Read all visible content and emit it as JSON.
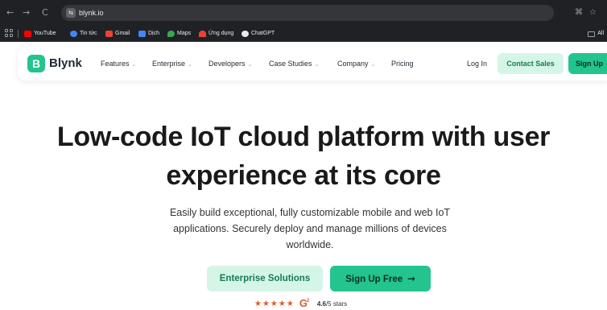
{
  "browser": {
    "url": "blynk.io",
    "site_icon": "⇆",
    "back_icon": "←",
    "forward_icon": "→",
    "reload_icon": "C",
    "translate_icon": "⌘",
    "bookmark_star_icon": "☆",
    "bookmarks": [
      {
        "label": "YouTube",
        "icon": "youtube-icon",
        "color": "#ff0000"
      },
      {
        "label": "Tin tức",
        "icon": "news-icon",
        "color": "#4285f4"
      },
      {
        "label": "Gmail",
        "icon": "gmail-icon",
        "color": "#ea4335"
      },
      {
        "label": "Dịch",
        "icon": "translate-icon",
        "color": "#4285f4"
      },
      {
        "label": "Maps",
        "icon": "maps-icon",
        "color": "#34a853"
      },
      {
        "label": "Ứng dụng",
        "icon": "apps-icon",
        "color": "#ea4335"
      },
      {
        "label": "ChatGPT",
        "icon": "chatgpt-icon",
        "color": "#e8eaed"
      }
    ],
    "all_bookmarks_label": "All"
  },
  "header": {
    "logo_mark": "B",
    "logo_text": "Blynk",
    "nav": [
      {
        "label": "Features",
        "dropdown": true
      },
      {
        "label": "Enterprise",
        "dropdown": true
      },
      {
        "label": "Developers",
        "dropdown": true
      },
      {
        "label": "Case Studies",
        "dropdown": true
      },
      {
        "label": "Company",
        "dropdown": true
      },
      {
        "label": "Pricing",
        "dropdown": false
      }
    ],
    "chevron": "⌄",
    "login_label": "Log In",
    "contact_label": "Contact Sales",
    "signup_label": "Sign Up"
  },
  "hero": {
    "title_line1": "Low-code IoT cloud platform with user",
    "title_line2": "experience at its core",
    "subtitle": "Easily build exceptional, fully customizable mobile and web IoT applications. Securely deploy and manage millions of devices worldwide.",
    "enterprise_button": "Enterprise Solutions",
    "signup_free_button": "Sign Up Free",
    "arrow": "→",
    "stars": "★★★★★",
    "g2_letter": "G",
    "g2_sup": "2",
    "rating_value": "4.6",
    "rating_suffix": "/5 stars"
  },
  "colors": {
    "brand": "#23c48e",
    "brand_light": "#d5f5e7",
    "chrome": "#202124"
  }
}
